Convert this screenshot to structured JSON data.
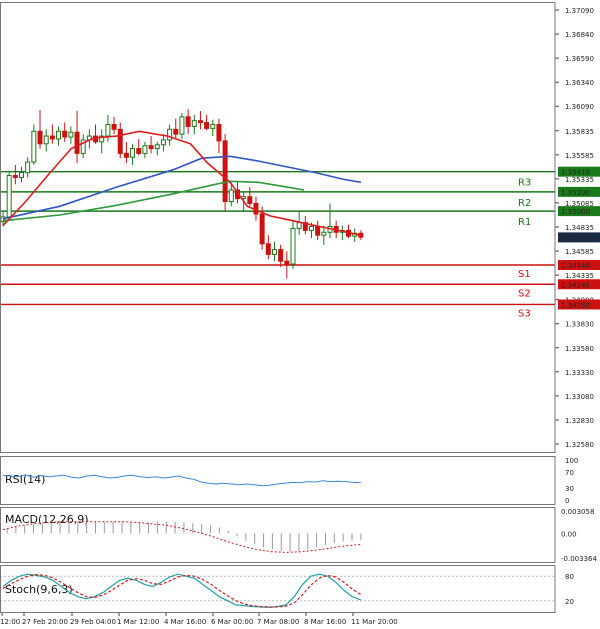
{
  "chart_data": {
    "type": "candlestick",
    "main_panel": {
      "ylim": [
        1.3258,
        1.3709
      ],
      "y_ticks": [
        "1.37090",
        "1.36840",
        "1.36590",
        "1.36340",
        "1.36090",
        "1.35835",
        "1.35585",
        "1.35335",
        "1.35085",
        "1.34835",
        "1.34585",
        "1.34335",
        "1.34080",
        "1.33830",
        "1.33580",
        "1.33330",
        "1.33080",
        "1.32830",
        "1.32580"
      ],
      "current_price": "1.34727",
      "levels": [
        {
          "name": "R3",
          "price": "1.35410",
          "color": "#1a7a1a"
        },
        {
          "name": "R2",
          "price": "1.35200",
          "color": "#1a7a1a"
        },
        {
          "name": "R1",
          "price": "1.35000",
          "color": "#1a7a1a"
        },
        {
          "name": "S1",
          "price": "1.34440",
          "color": "#cc1111"
        },
        {
          "name": "S2",
          "price": "1.34240",
          "color": "#cc1111"
        },
        {
          "name": "S3",
          "price": "1.34030",
          "color": "#cc1111"
        }
      ],
      "candles": [
        [
          1.3489,
          1.3499,
          1.3484,
          1.3494
        ],
        [
          1.3494,
          1.3542,
          1.349,
          1.3537
        ],
        [
          1.3537,
          1.3548,
          1.3528,
          1.3535
        ],
        [
          1.3535,
          1.3546,
          1.353,
          1.354
        ],
        [
          1.354,
          1.3556,
          1.3535,
          1.3551
        ],
        [
          1.3551,
          1.359,
          1.3548,
          1.3583
        ],
        [
          1.3583,
          1.3605,
          1.3565,
          1.357
        ],
        [
          1.357,
          1.3585,
          1.3562,
          1.3578
        ],
        [
          1.3578,
          1.359,
          1.357,
          1.3575
        ],
        [
          1.3575,
          1.3588,
          1.3568,
          1.3583
        ],
        [
          1.3583,
          1.3592,
          1.3572,
          1.3577
        ],
        [
          1.3577,
          1.3588,
          1.357,
          1.3582
        ],
        [
          1.3582,
          1.3604,
          1.355,
          1.356
        ],
        [
          1.356,
          1.358,
          1.3555,
          1.3574
        ],
        [
          1.3574,
          1.3585,
          1.3565,
          1.3578
        ],
        [
          1.3578,
          1.359,
          1.357,
          1.3572
        ],
        [
          1.3572,
          1.3585,
          1.356,
          1.3578
        ],
        [
          1.3578,
          1.36,
          1.3572,
          1.359
        ],
        [
          1.359,
          1.3598,
          1.358,
          1.3585
        ],
        [
          1.3585,
          1.3592,
          1.3555,
          1.356
        ],
        [
          1.356,
          1.3572,
          1.355,
          1.3556
        ],
        [
          1.3556,
          1.357,
          1.3548,
          1.3565
        ],
        [
          1.3565,
          1.3575,
          1.3558,
          1.356
        ],
        [
          1.356,
          1.3572,
          1.3555,
          1.3568
        ],
        [
          1.3568,
          1.3578,
          1.356,
          1.3565
        ],
        [
          1.3565,
          1.3572,
          1.3558,
          1.3569
        ],
        [
          1.3569,
          1.358,
          1.3562,
          1.3574
        ],
        [
          1.3574,
          1.359,
          1.3568,
          1.3585
        ],
        [
          1.3585,
          1.3596,
          1.3575,
          1.358
        ],
        [
          1.358,
          1.3602,
          1.3575,
          1.3598
        ],
        [
          1.3598,
          1.3606,
          1.358,
          1.3588
        ],
        [
          1.3588,
          1.36,
          1.358,
          1.3594
        ],
        [
          1.3594,
          1.3604,
          1.3585,
          1.3592
        ],
        [
          1.3592,
          1.36,
          1.3584,
          1.3586
        ],
        [
          1.3586,
          1.3595,
          1.3578,
          1.359
        ],
        [
          1.359,
          1.3596,
          1.356,
          1.3573
        ],
        [
          1.3573,
          1.358,
          1.35,
          1.351
        ],
        [
          1.351,
          1.3528,
          1.3505,
          1.3522
        ],
        [
          1.3522,
          1.353,
          1.3508,
          1.3513
        ],
        [
          1.3513,
          1.352,
          1.35,
          1.3515
        ],
        [
          1.3515,
          1.3525,
          1.3505,
          1.3508
        ],
        [
          1.3508,
          1.3515,
          1.349,
          1.3497
        ],
        [
          1.3497,
          1.3505,
          1.346,
          1.3466
        ],
        [
          1.3466,
          1.3475,
          1.345,
          1.3455
        ],
        [
          1.3455,
          1.3468,
          1.3448,
          1.346
        ],
        [
          1.346,
          1.3465,
          1.3442,
          1.3448
        ],
        [
          1.3448,
          1.3458,
          1.343,
          1.3445
        ],
        [
          1.3445,
          1.349,
          1.344,
          1.3482
        ],
        [
          1.3482,
          1.35,
          1.3475,
          1.3488
        ],
        [
          1.3488,
          1.3495,
          1.3476,
          1.348
        ],
        [
          1.348,
          1.3488,
          1.3472,
          1.3484
        ],
        [
          1.3484,
          1.349,
          1.347,
          1.3475
        ],
        [
          1.3475,
          1.3485,
          1.3465,
          1.3478
        ],
        [
          1.3478,
          1.3508,
          1.3472,
          1.3484
        ],
        [
          1.3484,
          1.349,
          1.3472,
          1.3478
        ],
        [
          1.3478,
          1.3485,
          1.347,
          1.348
        ],
        [
          1.348,
          1.3486,
          1.3472,
          1.3474
        ],
        [
          1.3474,
          1.3482,
          1.3468,
          1.3477
        ],
        [
          1.3477,
          1.348,
          1.347,
          1.3473
        ]
      ],
      "ma_red": [
        [
          0,
          1.3485
        ],
        [
          8,
          1.351
        ],
        [
          16,
          1.3538
        ],
        [
          24,
          1.3565
        ],
        [
          32,
          1.3576
        ],
        [
          40,
          1.3578
        ],
        [
          48,
          1.3583
        ],
        [
          58,
          1.3578
        ],
        [
          66,
          1.357
        ],
        [
          72,
          1.355
        ],
        [
          80,
          1.353
        ],
        [
          86,
          1.3505
        ],
        [
          94,
          1.3495
        ],
        [
          102,
          1.349
        ],
        [
          110,
          1.3485
        ],
        [
          118,
          1.348
        ],
        [
          126,
          1.3475
        ]
      ],
      "ma_blue": [
        [
          0,
          1.3492
        ],
        [
          20,
          1.3505
        ],
        [
          40,
          1.3525
        ],
        [
          60,
          1.3543
        ],
        [
          70,
          1.3555
        ],
        [
          80,
          1.3557
        ],
        [
          90,
          1.3552
        ],
        [
          100,
          1.3546
        ],
        [
          110,
          1.354
        ],
        [
          120,
          1.3533
        ],
        [
          126,
          1.353
        ]
      ],
      "ma_green": [
        [
          0,
          1.349
        ],
        [
          20,
          1.3496
        ],
        [
          40,
          1.3506
        ],
        [
          60,
          1.3518
        ],
        [
          75,
          1.3528
        ],
        [
          80,
          1.3531
        ],
        [
          90,
          1.353
        ],
        [
          100,
          1.3525
        ],
        [
          106,
          1.3522
        ]
      ]
    },
    "rsi_panel": {
      "label": "RSI(14)",
      "y_ticks": [
        "100",
        "70",
        "30",
        "0"
      ],
      "ylim": [
        0,
        100
      ],
      "values": [
        62,
        60,
        58,
        63,
        57,
        61,
        58,
        60,
        62,
        57,
        55,
        60,
        62,
        58,
        55,
        57,
        60,
        62,
        58,
        56,
        58,
        55,
        57,
        60,
        55,
        52,
        45,
        42,
        40,
        42,
        40,
        38,
        40,
        38,
        36,
        37,
        40,
        42,
        44,
        43,
        46,
        45,
        48,
        46,
        47,
        46,
        44,
        43
      ]
    },
    "macd_panel": {
      "label": "MACD(12,26,9)",
      "y_ticks": [
        "0.003058",
        "0.00",
        "-0.003364"
      ],
      "ylim": [
        -0.003364,
        0.003058
      ],
      "histogram": [
        0.0006,
        0.0009,
        0.0011,
        0.0012,
        0.0013,
        0.0014,
        0.0015,
        0.0016,
        0.0015,
        0.0015,
        0.0016,
        0.0016,
        0.0016,
        0.0015,
        0.0016,
        0.0015,
        0.0015,
        0.0016,
        0.0016,
        0.0016,
        0.0015,
        0.0014,
        0.0013,
        0.0011,
        0.0008,
        0.0004,
        -0.0004,
        -0.001,
        -0.0015,
        -0.0019,
        -0.0022,
        -0.0024,
        -0.0025,
        -0.0024,
        -0.0022,
        -0.0019,
        -0.0016,
        -0.0013,
        -0.0011,
        -0.001,
        -0.0009
      ],
      "signal": [
        0.0005,
        0.001,
        0.0013,
        0.0015,
        0.0016,
        0.0016,
        0.0016,
        0.0016,
        0.0016,
        0.0015,
        0.0013,
        0.0011,
        0.0007,
        0.0002,
        -0.0004,
        -0.0011,
        -0.0017,
        -0.0022,
        -0.0025,
        -0.0026,
        -0.0025,
        -0.0023,
        -0.002,
        -0.0017,
        -0.0015
      ]
    },
    "stoch_panel": {
      "label": "Stoch(9,6,3)",
      "y_ticks": [
        "80",
        "20"
      ],
      "ylim": [
        0,
        100
      ],
      "main": [
        55,
        70,
        80,
        85,
        82,
        78,
        70,
        55,
        40,
        30,
        25,
        30,
        40,
        55,
        70,
        75,
        70,
        60,
        55,
        65,
        78,
        85,
        80,
        75,
        60,
        45,
        30,
        20,
        10,
        8,
        6,
        5,
        4,
        6,
        10,
        30,
        60,
        80,
        85,
        80,
        65,
        45,
        30,
        22
      ],
      "signal": [
        50,
        62,
        72,
        80,
        84,
        82,
        76,
        65,
        52,
        40,
        30,
        28,
        34,
        45,
        58,
        70,
        74,
        70,
        62,
        60,
        68,
        78,
        82,
        80,
        72,
        60,
        45,
        32,
        20,
        12,
        8,
        6,
        5,
        5,
        7,
        15,
        35,
        58,
        75,
        82,
        78,
        65,
        48,
        35
      ]
    },
    "x_labels": [
      "12:00",
      "27 Feb 20:00",
      "29 Feb 04:00",
      "1 Mar 12:00",
      "4 Mar 16:00",
      "6 Mar 00:00",
      "7 Mar 08:00",
      "8 Mar 16:00",
      "11 Mar 20:00"
    ]
  },
  "colors": {
    "bull": "#1a7a1a",
    "bear": "#cc1111",
    "ma_red": "#e01b1b",
    "ma_blue": "#2f55c8",
    "ma_green": "#2e9a3a",
    "rsi": "#3a88d8",
    "macd_hist": "#9a9a9a",
    "macd_signal": "#d02020",
    "stoch_main": "#20a0a8",
    "stoch_signal": "#d02020",
    "price_box": "#1b2a44"
  }
}
